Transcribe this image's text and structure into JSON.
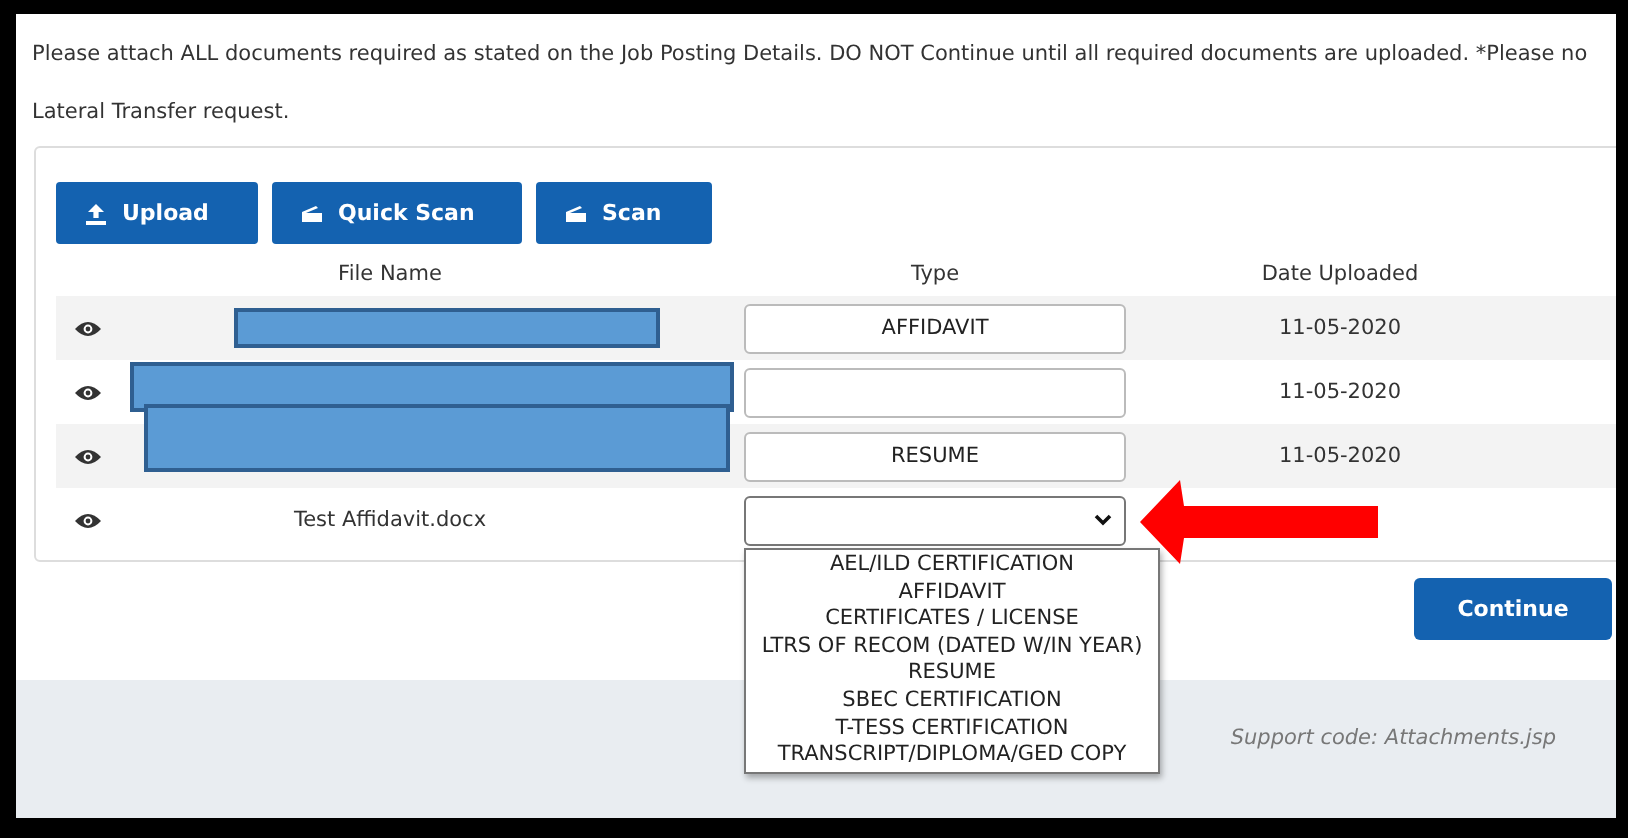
{
  "notice": [
    "Please attach ALL documents required as stated on the Job Posting Details. DO NOT Continue until all required documents are uploaded. *Please no",
    "Lateral Transfer request."
  ],
  "toolbar": [
    {
      "label": "Upload",
      "kind": "upload"
    },
    {
      "label": "Quick Scan",
      "kind": "scan"
    },
    {
      "label": "Scan",
      "kind": "scan"
    }
  ],
  "table": {
    "columns": [
      "File Name",
      "Type",
      "Date Uploaded"
    ],
    "rows": [
      {
        "file_name": "",
        "redacted": true,
        "type": "AFFIDAVIT",
        "kind": "text",
        "date": "11-05-2020"
      },
      {
        "file_name": "",
        "redacted": true,
        "type": "",
        "kind": "text",
        "date": "11-05-2020"
      },
      {
        "file_name": "",
        "redacted": true,
        "type": "RESUME",
        "kind": "text",
        "date": "11-05-2020"
      },
      {
        "file_name": "Test Affidavit.docx",
        "redacted": false,
        "kind": "select",
        "expanded": true,
        "date": ""
      }
    ]
  },
  "type_options": [
    "AEL/ILD CERTIFICATION",
    "AFFIDAVIT",
    "CERTIFICATES / LICENSE",
    "LTRS OF RECOM (DATED W/IN YEAR)",
    "RESUME",
    "SBEC CERTIFICATION",
    "T-TESS CERTIFICATION",
    "TRANSCRIPT/DIPLOMA/GED COPY"
  ],
  "continue_button": "Continue",
  "support_code": "Support code: Attachments.jsp"
}
